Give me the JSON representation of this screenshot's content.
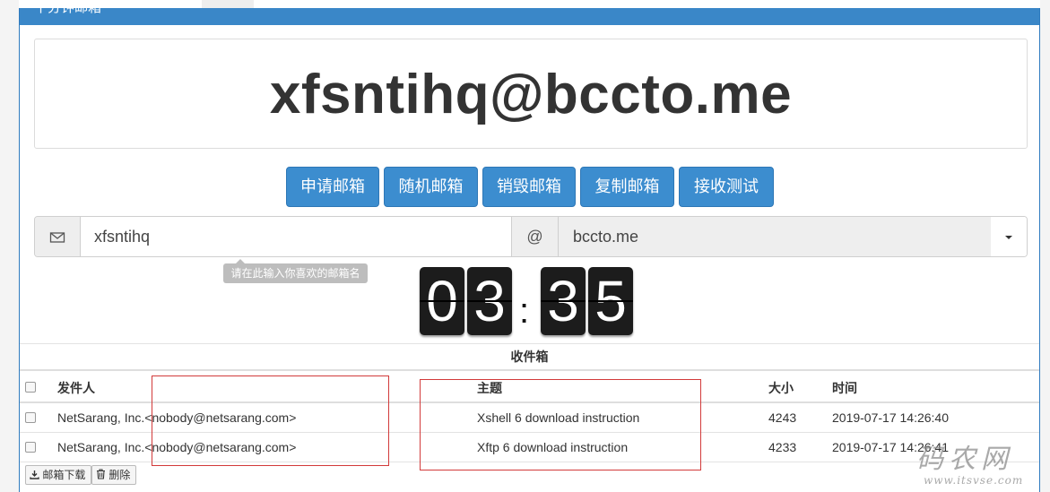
{
  "panel": {
    "title": "十分钟邮箱"
  },
  "address": {
    "full": "xfsntihq@bccto.me"
  },
  "buttons": [
    {
      "label": "申请邮箱"
    },
    {
      "label": "随机邮箱"
    },
    {
      "label": "销毁邮箱"
    },
    {
      "label": "复制邮箱"
    },
    {
      "label": "接收测试"
    }
  ],
  "mail_input": {
    "icon": "envelope-icon",
    "value": "xfsntihq",
    "at": "@",
    "domain": "bccto.me",
    "tooltip": "请在此输入你喜欢的邮箱名"
  },
  "timer": {
    "d1": "0",
    "d2": "3",
    "sep": ":",
    "d3": "3",
    "d4": "5"
  },
  "inbox": {
    "title": "收件箱",
    "columns": {
      "sender": "发件人",
      "subject": "主题",
      "size": "大小",
      "time": "时间"
    },
    "rows": [
      {
        "sender": "NetSarang, Inc.<nobody@netsarang.com>",
        "subject": "Xshell 6 download instruction",
        "size": "4243",
        "time": "2019-07-17 14:26:40"
      },
      {
        "sender": "NetSarang, Inc.<nobody@netsarang.com>",
        "subject": "Xftp 6 download instruction",
        "size": "4233",
        "time": "2019-07-17 14:26:41"
      }
    ],
    "download_label": "邮箱下载",
    "delete_label": "删除"
  },
  "watermark": {
    "big": "码农网",
    "small": "www.itsvse.com"
  },
  "colors": {
    "primary": "#3c8dcf",
    "header": "#3a87c8",
    "highlight": "#d23a3a"
  }
}
